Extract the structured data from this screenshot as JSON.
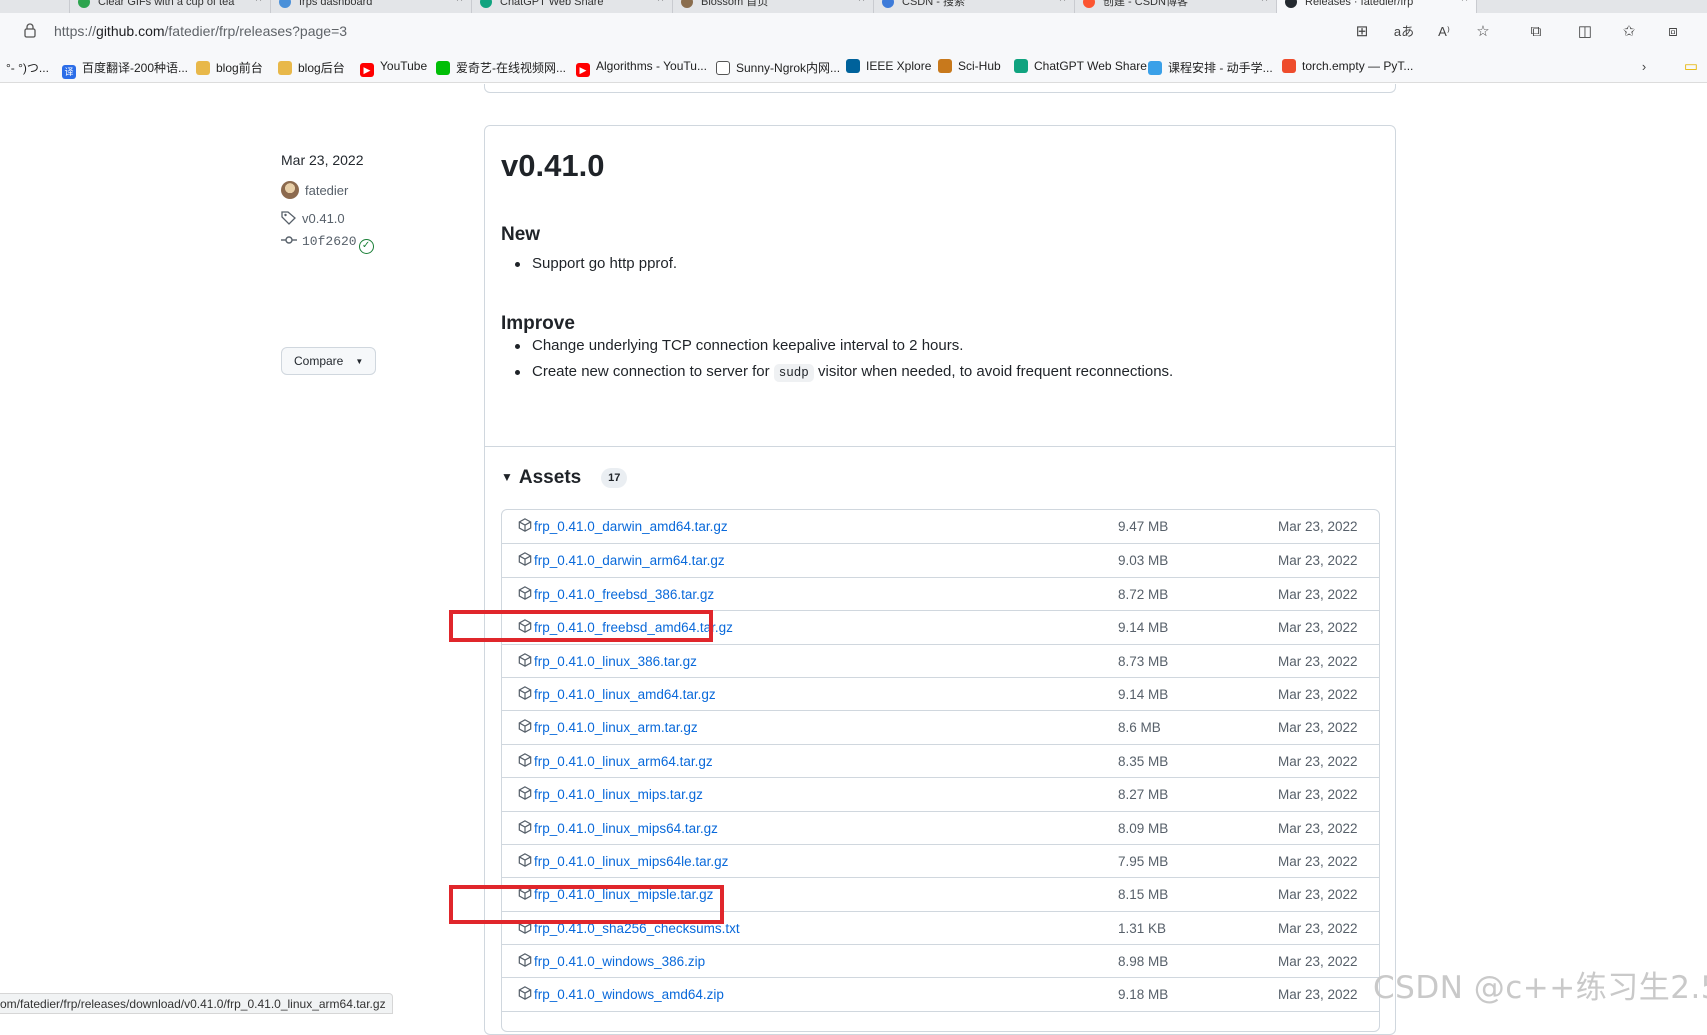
{
  "browser": {
    "tabs": [
      {
        "label": "Clear GIFs with a cup of tea",
        "fav": "#2da44e"
      },
      {
        "label": "frps dashboard",
        "fav": "#4a90d9"
      },
      {
        "label": "ChatGPT Web Share",
        "fav": "#10a37f"
      },
      {
        "label": "Blossom 首页",
        "fav": "#8a6d4e"
      },
      {
        "label": "CSDN - 搜索",
        "fav": "#3d7bd9"
      },
      {
        "label": "创建 - CSDN博客",
        "fav": "#fc5531"
      },
      {
        "label": "Releases · fatedier/frp",
        "fav": "#24292f"
      }
    ],
    "url_prefix": "https://",
    "url_host": "github.com",
    "url_path": "/fatedier/frp/releases?page=3",
    "toolbar_icons": [
      "app-grid-icon",
      "translate-icon",
      "read-aloud-icon",
      "favorite-star-icon",
      "extensions-icon",
      "split-screen-icon",
      "favorites-icon",
      "collections-icon"
    ],
    "bookmarks": [
      {
        "label": "°- °)つ...",
        "icon": "",
        "color": "transparent"
      },
      {
        "label": "百度翻译-200种语...",
        "icon": "译",
        "color": "#2b6de8"
      },
      {
        "label": "blog前台",
        "icon": "",
        "color": "#e8b84a"
      },
      {
        "label": "blog后台",
        "icon": "",
        "color": "#e8b84a"
      },
      {
        "label": "YouTube",
        "icon": "▶",
        "color": "#ff0000"
      },
      {
        "label": "爱奇艺-在线视频网...",
        "icon": "",
        "color": "#00be06"
      },
      {
        "label": "Algorithms - YouTu...",
        "icon": "▶",
        "color": "#ff0000"
      },
      {
        "label": "Sunny-Ngrok内网...",
        "icon": "",
        "color": "#ffffff"
      },
      {
        "label": "IEEE Xplore",
        "icon": "",
        "color": "#00629b"
      },
      {
        "label": "Sci-Hub",
        "icon": "",
        "color": "#c8791c"
      },
      {
        "label": "ChatGPT Web Share",
        "icon": "",
        "color": "#10a37f"
      },
      {
        "label": "课程安排 - 动手学...",
        "icon": "",
        "color": "#3aa0e8"
      },
      {
        "label": "torch.empty — PyT...",
        "icon": "",
        "color": "#ee4c2c"
      }
    ]
  },
  "sidebar": {
    "date": "Mar 23, 2022",
    "author": "fatedier",
    "tag": "v0.41.0",
    "commit": "10f2620",
    "compare_label": "Compare"
  },
  "release": {
    "title": "v0.41.0",
    "new_heading": "New",
    "new_items": [
      "Support go http pprof."
    ],
    "improve_heading": "Improve",
    "improve_item_1": "Change underlying TCP connection keepalive interval to 2 hours.",
    "improve_item_2_before": "Create new connection to server for ",
    "improve_item_2_code": "sudp",
    "improve_item_2_after": " visitor when needed, to avoid frequent reconnections.",
    "assets_heading": "Assets",
    "assets_count": "17",
    "assets": [
      {
        "name": "frp_0.41.0_darwin_amd64.tar.gz",
        "size": "9.47 MB",
        "date": "Mar 23, 2022"
      },
      {
        "name": "frp_0.41.0_darwin_arm64.tar.gz",
        "size": "9.03 MB",
        "date": "Mar 23, 2022"
      },
      {
        "name": "frp_0.41.0_freebsd_386.tar.gz",
        "size": "8.72 MB",
        "date": "Mar 23, 2022"
      },
      {
        "name": "frp_0.41.0_freebsd_amd64.tar.gz",
        "size": "9.14 MB",
        "date": "Mar 23, 2022"
      },
      {
        "name": "frp_0.41.0_linux_386.tar.gz",
        "size": "8.73 MB",
        "date": "Mar 23, 2022"
      },
      {
        "name": "frp_0.41.0_linux_amd64.tar.gz",
        "size": "9.14 MB",
        "date": "Mar 23, 2022"
      },
      {
        "name": "frp_0.41.0_linux_arm.tar.gz",
        "size": "8.6 MB",
        "date": "Mar 23, 2022"
      },
      {
        "name": "frp_0.41.0_linux_arm64.tar.gz",
        "size": "8.35 MB",
        "date": "Mar 23, 2022"
      },
      {
        "name": "frp_0.41.0_linux_mips.tar.gz",
        "size": "8.27 MB",
        "date": "Mar 23, 2022"
      },
      {
        "name": "frp_0.41.0_linux_mips64.tar.gz",
        "size": "8.09 MB",
        "date": "Mar 23, 2022"
      },
      {
        "name": "frp_0.41.0_linux_mips64le.tar.gz",
        "size": "7.95 MB",
        "date": "Mar 23, 2022"
      },
      {
        "name": "frp_0.41.0_linux_mipsle.tar.gz",
        "size": "8.15 MB",
        "date": "Mar 23, 2022"
      },
      {
        "name": "frp_0.41.0_sha256_checksums.txt",
        "size": "1.31 KB",
        "date": "Mar 23, 2022"
      },
      {
        "name": "frp_0.41.0_windows_386.zip",
        "size": "8.98 MB",
        "date": "Mar 23, 2022"
      },
      {
        "name": "frp_0.41.0_windows_amd64.zip",
        "size": "9.18 MB",
        "date": "Mar 23, 2022"
      }
    ]
  },
  "highlight_color": "#e0262b",
  "status_bar": "om/fatedier/frp/releases/download/v0.41.0/frp_0.41.0_linux_arm64.tar.gz",
  "watermark": "CSDN @c++练习生2.5"
}
